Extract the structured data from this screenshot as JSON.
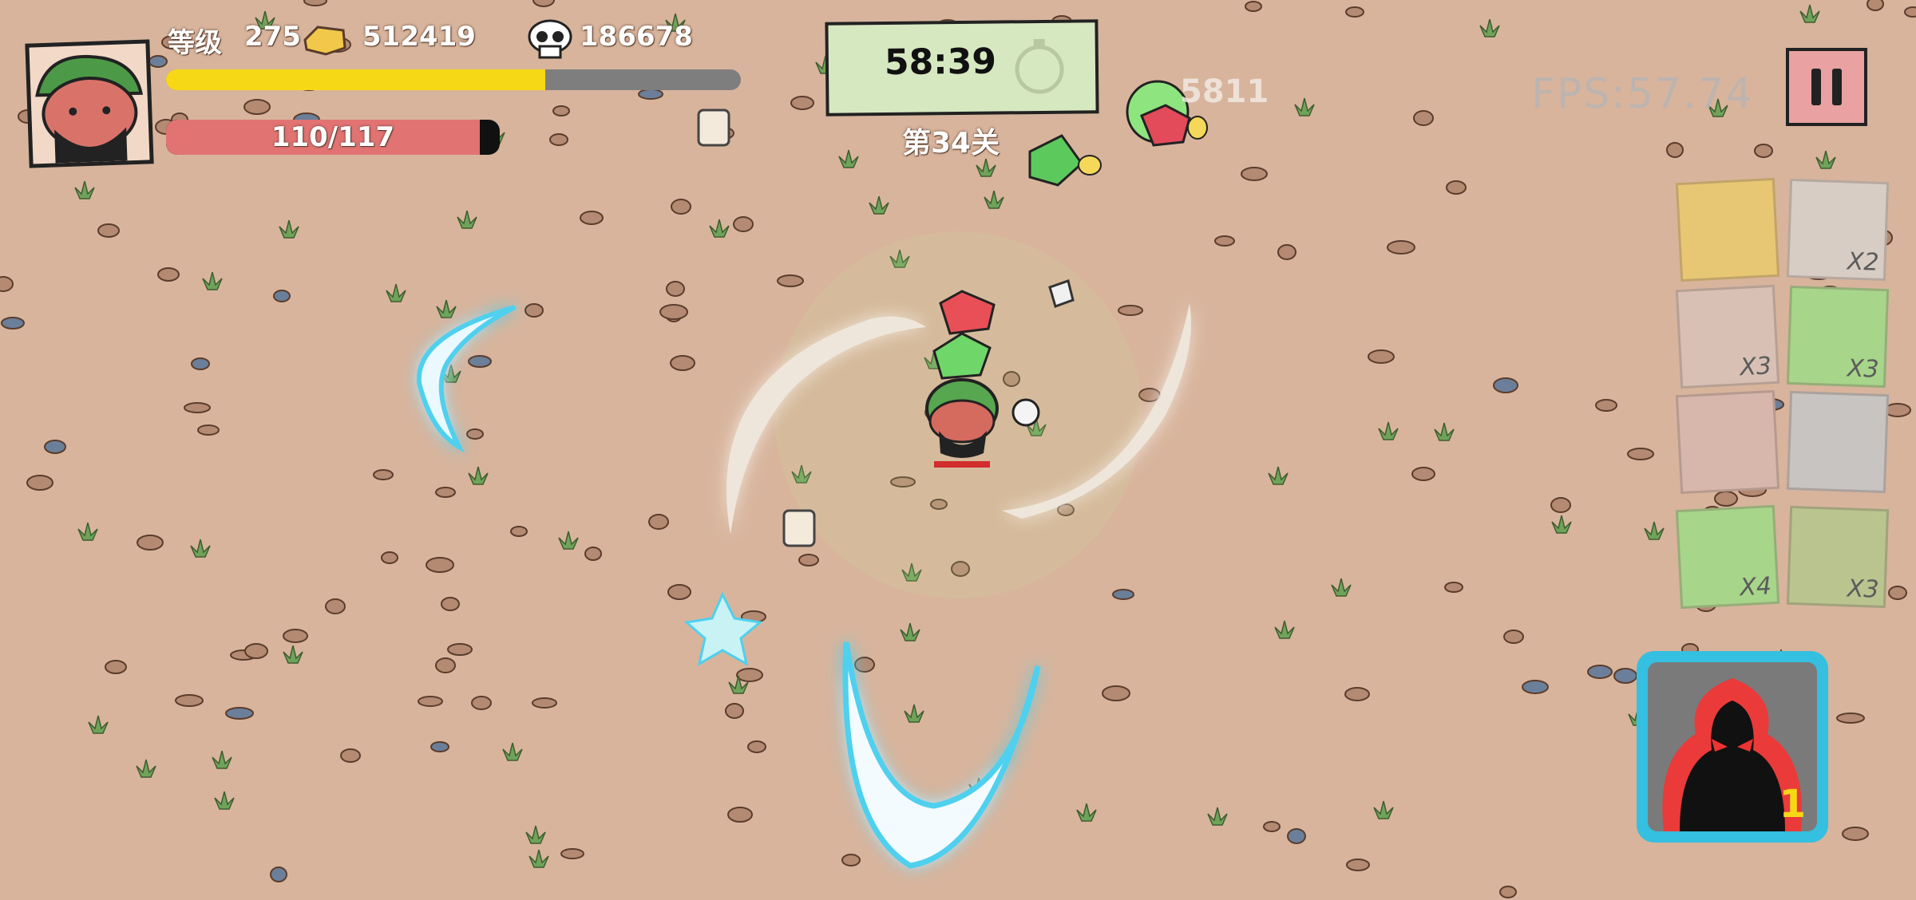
{
  "hud": {
    "level_label": "等级",
    "level_value": "275",
    "gold_value": "512419",
    "kills_value": "186678",
    "xp_fraction": 0.66,
    "hp_text": "110/117",
    "hp_fraction": 0.9402,
    "timer": "58:39",
    "stage": "第34关",
    "fps": "FPS:57.74",
    "damage_number": "5811"
  },
  "items": [
    {
      "name": "food-plate-icon",
      "label": ""
    },
    {
      "name": "tea-cup-icon",
      "label": "X2"
    },
    {
      "name": "roast-chicken-icon",
      "label": "X3"
    },
    {
      "name": "swirl-candy-icon",
      "label": "X3"
    },
    {
      "name": "lobster-icon",
      "label": ""
    },
    {
      "name": "meat-skewer-icon",
      "label": ""
    },
    {
      "name": "green-mug-icon",
      "label": "X4"
    },
    {
      "name": "roast-duck-icon",
      "label": "X3"
    }
  ],
  "skill": {
    "icon": "rage-demon-icon",
    "count": "1"
  },
  "colors": {
    "ground": "#d8b49c",
    "xp_fill": "#f7d816",
    "hp_fill": "#e27373",
    "timer_bg": "#d6e8c0",
    "pause_bg": "#e9a1a1",
    "skill_border": "#35bfe0",
    "slash_blue": "#4fd0ee",
    "slash_green": "#bfe28a"
  }
}
